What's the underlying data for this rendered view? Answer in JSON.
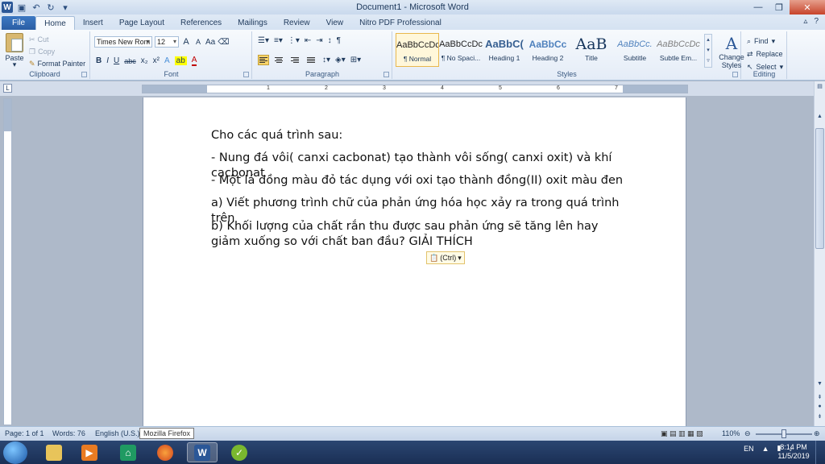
{
  "window": {
    "title": "Document1 - Microsoft Word",
    "app_logo": "W",
    "qat_icons": [
      "save-icon",
      "undo-icon",
      "redo-icon",
      "customize-icon"
    ]
  },
  "tabs": [
    "File",
    "Home",
    "Insert",
    "Page Layout",
    "References",
    "Mailings",
    "Review",
    "View",
    "Nitro PDF Professional"
  ],
  "clipboard": {
    "paste": "Paste",
    "cut": "Cut",
    "copy": "Copy",
    "format_painter": "Format Painter",
    "label": "Clipboard"
  },
  "font": {
    "name": "Times New Rom",
    "size": "12",
    "label": "Font",
    "grow": "A",
    "shrink": "A",
    "case": "Aa",
    "bold": "B",
    "italic": "I",
    "underline": "U",
    "strike": "abc",
    "sub": "x₂",
    "sup": "x²"
  },
  "paragraph": {
    "label": "Paragraph",
    "pilcrow": "¶"
  },
  "styles": {
    "label": "Styles",
    "items": [
      {
        "sample": "AaBbCcDc",
        "name": "¶ Normal"
      },
      {
        "sample": "AaBbCcDc",
        "name": "¶ No Spaci..."
      },
      {
        "sample": "AaBbC(",
        "name": "Heading 1"
      },
      {
        "sample": "AaBbCc",
        "name": "Heading 2"
      },
      {
        "sample": "AaB",
        "name": "Title"
      },
      {
        "sample": "AaBbCc.",
        "name": "Subtitle"
      },
      {
        "sample": "AaBbCcDc",
        "name": "Subtle Em..."
      }
    ],
    "change_styles_glyph": "A",
    "change_styles": "Change Styles"
  },
  "editing": {
    "label": "Editing",
    "find": "Find",
    "replace": "Replace",
    "select": "Select"
  },
  "ruler": {
    "corner": "L",
    "numbers": [
      "1",
      "2",
      "3",
      "4",
      "5",
      "6",
      "7"
    ]
  },
  "document": {
    "paragraphs": [
      "Cho các quá trình sau:",
      "- Nung đá vôi( canxi cacbonat) tạo thành vôi sống( canxi oxit) và khí cacbonat",
      "- Một lá đồng màu đỏ tác dụng với oxi tạo thành đồng(II) oxit màu đen",
      "a) Viết phương trình chữ của phản ứng hóa học xảy ra trong quá trình trên",
      "b) Khối lượng của chất rắn thu được sau phản ứng sẽ tăng lên hay giảm xuống so với chất ban đầu? GIẢI THÍCH"
    ],
    "paste_options": "(Ctrl)"
  },
  "status": {
    "page": "Page: 1 of 1",
    "words": "Words: 76",
    "language": "English (U.S.)",
    "tooltip": "Mozilla Firefox",
    "zoom": "110%"
  },
  "taskbar": {
    "lang": "EN",
    "time": "8:14 PM",
    "date": "11/5/2019"
  },
  "colors": {
    "accent": "#2b5797",
    "file_tab": "#2a5ea4",
    "taskbar": "#1a2f55"
  }
}
